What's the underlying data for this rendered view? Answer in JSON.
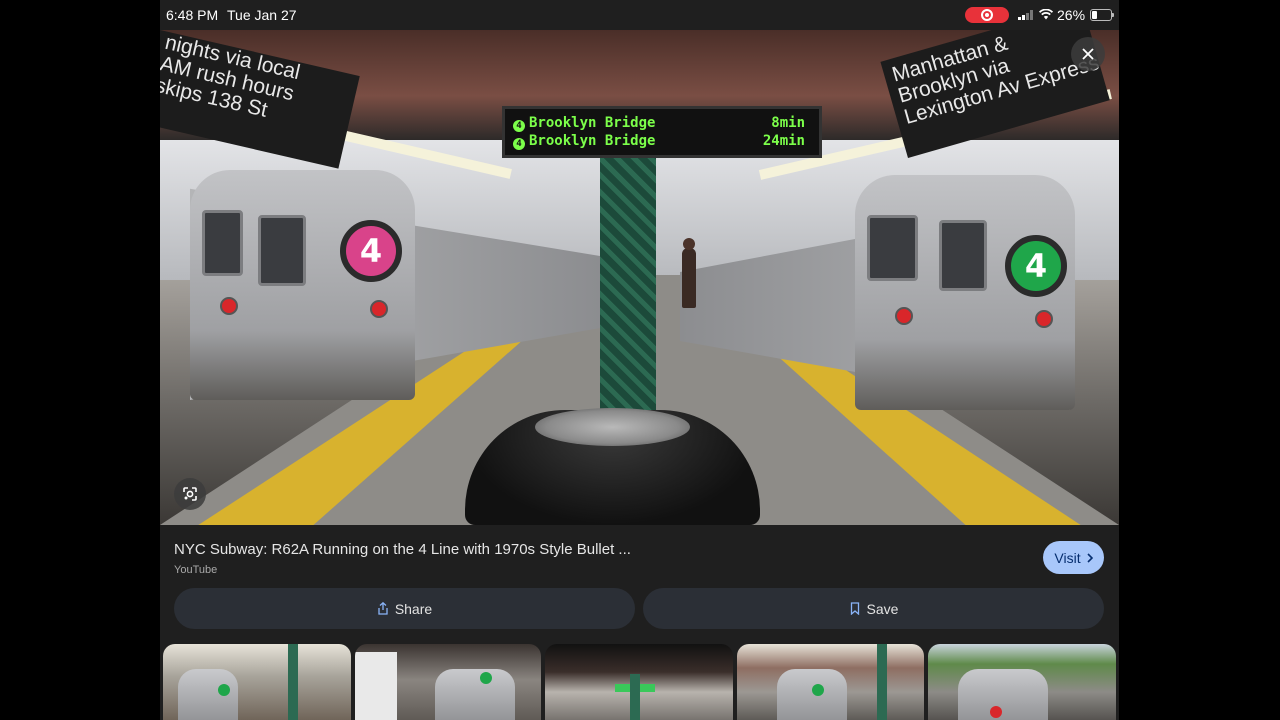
{
  "status_bar": {
    "time": "6:48 PM",
    "date": "Tue Jan 27",
    "battery_percent": "26%",
    "icons": [
      "screen-record-icon",
      "cellular-signal-icon",
      "wifi-icon",
      "battery-icon"
    ]
  },
  "image_viewer": {
    "photo_sign_left": "nights via local\nAM rush hours\nskips 138 St",
    "photo_sign_right": "Manhattan &\nBrooklyn via\nLexington Av Express",
    "led_rows": [
      {
        "route": "4",
        "dest": "Brooklyn Bridge",
        "time": "8min"
      },
      {
        "route": "4",
        "dest": "Brooklyn Bridge",
        "time": "24min"
      }
    ],
    "left_train_route": "4",
    "right_train_route": "4",
    "left_bullet_color": "#d9438a",
    "right_bullet_color": "#1fa64a"
  },
  "result": {
    "title": "NYC Subway: R62A Running on the 4 Line with 1970s Style Bullet ...",
    "source": "YouTube",
    "visit_label": "Visit",
    "share_label": "Share",
    "save_label": "Save"
  },
  "colors": {
    "visit_button": "#a8c7fa",
    "action_button": "#2b2f36",
    "background": "#1f1f1f"
  }
}
